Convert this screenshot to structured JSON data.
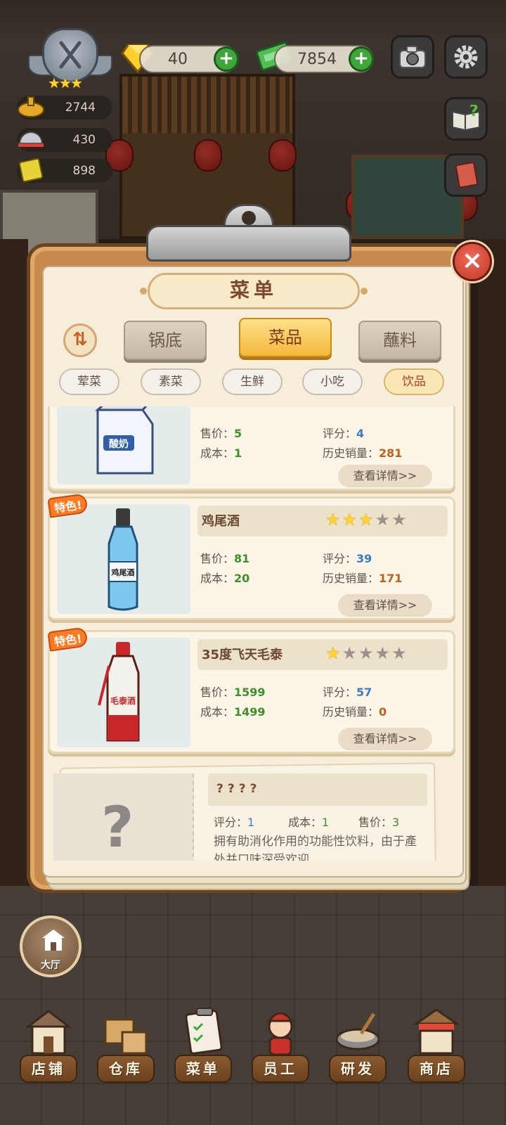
{
  "hud": {
    "gems": "40",
    "cash": "7854",
    "stats": [
      "2744",
      "430",
      "898"
    ]
  },
  "menu": {
    "title": "菜单",
    "tabs": [
      {
        "label": "锅底",
        "active": false
      },
      {
        "label": "菜品",
        "active": true
      },
      {
        "label": "蘸料",
        "active": false
      }
    ],
    "categories": [
      {
        "label": "荤菜",
        "active": false
      },
      {
        "label": "素菜",
        "active": false
      },
      {
        "label": "生鲜",
        "active": false
      },
      {
        "label": "小吃",
        "active": false
      },
      {
        "label": "饮品",
        "active": true
      }
    ],
    "labels": {
      "price": "售价",
      "cost": "成本",
      "score": "评分",
      "history_sales": "历史销量",
      "details_button": "查看详情>>",
      "feature_tag": "特色!"
    },
    "items": [
      {
        "name": "酸奶",
        "price": "5",
        "cost": "1",
        "score": "4",
        "sales": "281",
        "stars": 0,
        "featured": false,
        "bottle_text": "酸奶"
      },
      {
        "name": "鸡尾酒",
        "price": "81",
        "cost": "20",
        "score": "39",
        "sales": "171",
        "stars": 3,
        "featured": true,
        "bottle_text": "鸡尾酒"
      },
      {
        "name": "35度飞天毛泰",
        "price": "1599",
        "cost": "1499",
        "score": "57",
        "sales": "0",
        "stars": 1,
        "featured": true,
        "bottle_text": "毛泰酒"
      }
    ],
    "locked_item": {
      "name": "????",
      "score": "1",
      "cost": "1",
      "price": "3",
      "description": "拥有助消化作用的功能性饮料，由于產处并口味深受欢迎"
    }
  },
  "hall_button": {
    "label": "大厅"
  },
  "bottom_nav": [
    {
      "label": "店铺",
      "icon": "shop-icon"
    },
    {
      "label": "仓库",
      "icon": "warehouse-icon"
    },
    {
      "label": "菜单",
      "icon": "menu-icon"
    },
    {
      "label": "员工",
      "icon": "staff-icon"
    },
    {
      "label": "研发",
      "icon": "research-icon"
    },
    {
      "label": "商店",
      "icon": "store-icon"
    }
  ],
  "colors": {
    "accent_orange": "#f3b83a",
    "price_green": "#3e8f28",
    "score_blue": "#3c7ac2",
    "sales_orange": "#c06016",
    "close_red": "#c0392b"
  }
}
